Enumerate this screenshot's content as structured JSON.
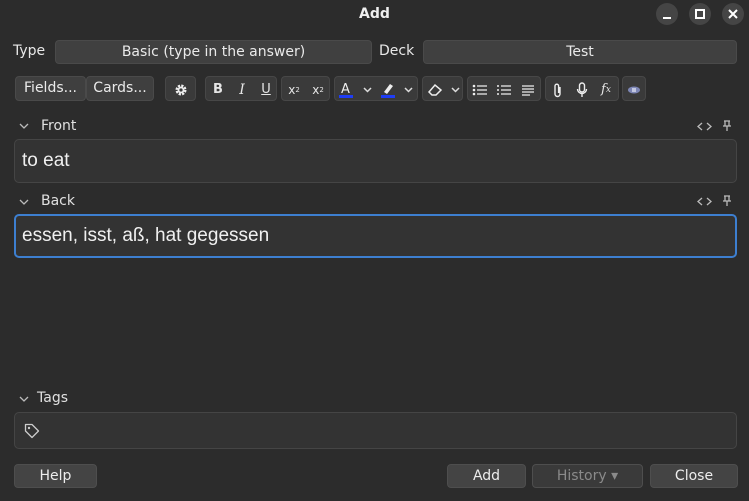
{
  "window": {
    "title": "Add"
  },
  "notetype": {
    "type_label": "Type",
    "type_value": "Basic (type in the answer)",
    "deck_label": "Deck",
    "deck_value": "Test"
  },
  "toolbar": {
    "fields_label": "Fields...",
    "cards_label": "Cards...",
    "icons": [
      "gear-icon",
      "bold-icon",
      "italic-icon",
      "underline-icon",
      "superscript-icon",
      "subscript-icon",
      "text-color-icon",
      "highlight-icon",
      "eraser-icon",
      "bullet-list-icon",
      "numbered-list-icon",
      "align-icon",
      "paperclip-icon",
      "microphone-icon",
      "function-icon",
      "image-occlusion-icon"
    ],
    "accent_color": "#1f3df5"
  },
  "fields": [
    {
      "label": "Front",
      "value": "to eat"
    },
    {
      "label": "Back",
      "value": "essen, isst, aß, hat gegessen"
    }
  ],
  "tags": {
    "label": "Tags"
  },
  "buttons": {
    "help": "Help",
    "add": "Add",
    "history": "History ▾",
    "close": "Close"
  },
  "colors": {
    "focus_border": "#3d7fd0",
    "background": "#2c2c2c"
  }
}
